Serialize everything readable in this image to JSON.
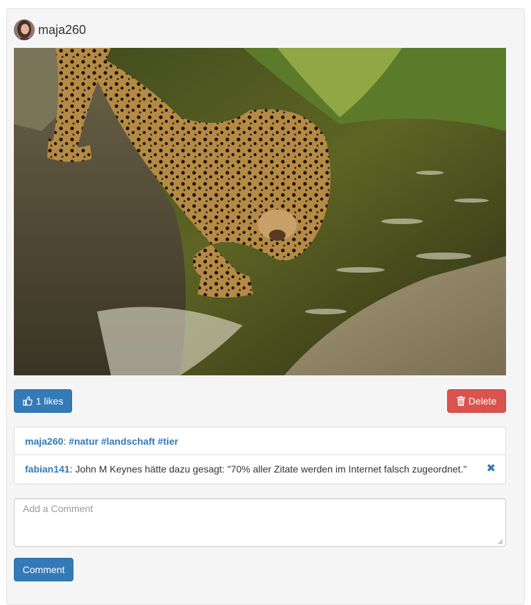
{
  "post": {
    "author": "maja260",
    "likes_label": "1 likes",
    "delete_label": "Delete"
  },
  "comments": [
    {
      "user": "maja260",
      "colon": ":",
      "tags": "#natur #landschaft #tier",
      "text": ""
    },
    {
      "user": "fabian141",
      "colon": ":",
      "tags": "",
      "text": "John M Keynes hätte dazu gesagt: \"70% aller Zitate werden im Internet falsch zugeordnet.\""
    }
  ],
  "comment_form": {
    "placeholder": "Add a Comment",
    "submit_label": "Comment"
  },
  "colors": {
    "primary": "#337ab7",
    "danger": "#d9534f",
    "panel_bg": "#f5f5f5"
  },
  "icons": {
    "like": "thumbs-up-icon",
    "delete": "trash-icon",
    "remove": "remove-icon"
  }
}
